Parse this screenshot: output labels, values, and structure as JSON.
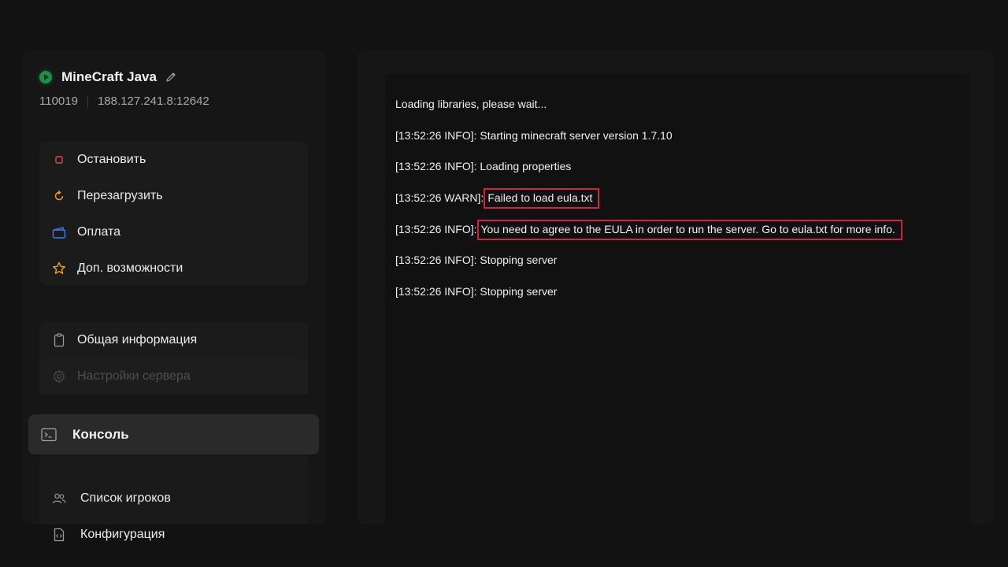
{
  "server": {
    "name": "MineCraft Java",
    "id": "110019",
    "address": "188.127.241.8:12642",
    "status_color": "#1e8f4a"
  },
  "actions": [
    {
      "label": "Остановить",
      "icon": "stop-icon",
      "color": "#e0444f"
    },
    {
      "label": "Перезагрузить",
      "icon": "restart-icon",
      "color": "#f0a020"
    },
    {
      "label": "Оплата",
      "icon": "wallet-icon",
      "color": "#3d7df0"
    },
    {
      "label": "Доп. возможности",
      "icon": "star-icon",
      "color": "#f0a020"
    }
  ],
  "info_group": [
    {
      "label": "Общая информация",
      "icon": "clipboard-icon",
      "enabled": true
    },
    {
      "label": "Настройки сервера",
      "icon": "gear-icon",
      "enabled": false
    }
  ],
  "nav": {
    "active": {
      "label": "Консоль",
      "icon": "terminal-icon"
    },
    "items": [
      {
        "label": "Список игроков",
        "icon": "users-icon"
      },
      {
        "label": "Конфигурация",
        "icon": "file-code-icon"
      }
    ]
  },
  "console": {
    "lines": [
      {
        "prefix": "Loading libraries, please wait...",
        "message": ""
      },
      {
        "prefix": "[13:52:26 INFO]: Starting minecraft server version 1.7.10",
        "message": ""
      },
      {
        "prefix": "[13:52:26 INFO]: Loading properties",
        "message": ""
      },
      {
        "prefix": "[13:52:26 WARN]:",
        "message": "Failed to load eula.txt"
      },
      {
        "prefix": "[13:52:26 INFO]:",
        "message": "You need to agree to the EULA in order to run the server. Go to eula.txt for more info."
      },
      {
        "prefix": "[13:52:26 INFO]: Stopping server",
        "message": ""
      },
      {
        "prefix": "[13:52:26 INFO]: Stopping server",
        "message": ""
      }
    ],
    "highlight_color": "#d1223b"
  }
}
